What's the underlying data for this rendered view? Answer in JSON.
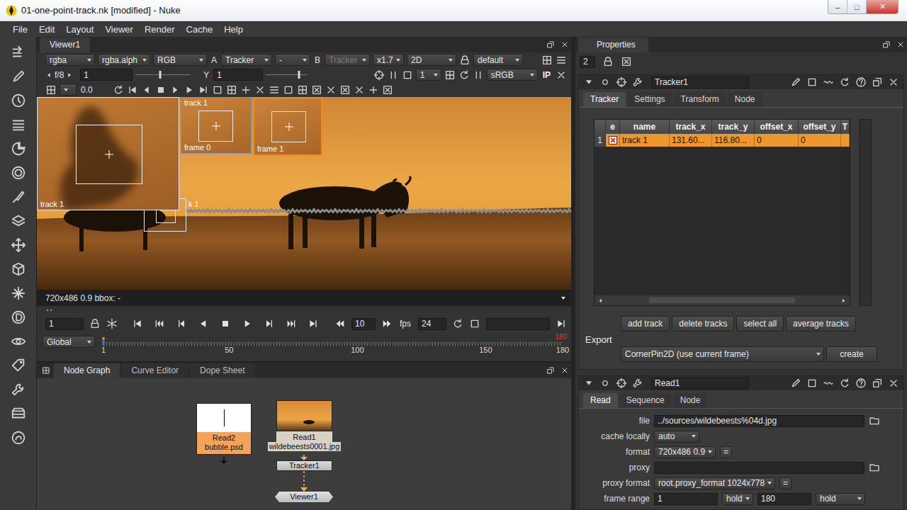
{
  "window": {
    "title": "01-one-point-track.nk [modified] - Nuke",
    "controls": [
      "–",
      "□",
      "✕"
    ]
  },
  "menu": [
    "File",
    "Edit",
    "Layout",
    "Viewer",
    "Render",
    "Cache",
    "Help"
  ],
  "viewer": {
    "tab": "Viewer1",
    "row1": [
      {
        "kind": "dropdown",
        "text": "rgba",
        "disabled": false
      },
      {
        "kind": "dropdown",
        "text": "rgba.alph",
        "disabled": false
      },
      {
        "kind": "dropdown",
        "text": "RGB",
        "disabled": false
      },
      {
        "kind": "label",
        "text": "A",
        "disabled": false
      },
      {
        "kind": "dropdown",
        "text": "Tracker",
        "disabled": false
      },
      {
        "kind": "dropdown",
        "text": "-",
        "disabled": false
      },
      {
        "kind": "label",
        "text": "B",
        "disabled": false
      },
      {
        "kind": "dropdown",
        "text": "Tracker",
        "disabled": true
      },
      {
        "kind": "dropdown",
        "text": "x1.7",
        "disabled": false
      },
      {
        "kind": "dropdown",
        "text": "2D",
        "disabled": false
      },
      {
        "kind": "dropdown",
        "text": "default",
        "disabled": false
      }
    ],
    "row2": {
      "fstop": "f/8",
      "gain": "1",
      "gainLevel": 0.45,
      "gammaLabel": "Y",
      "gamma": "1",
      "gammaLevel": 0.8,
      "proxyLevel": "1",
      "colorspace": "sRGB",
      "ip": "IP"
    },
    "row3": {
      "clip": "0.0"
    },
    "overlays": {
      "zoomLabel": "track 1",
      "thumbsTitle": "track 1",
      "thumbs": [
        {
          "label": "frame 0",
          "selected": false
        },
        {
          "label": "frame 1",
          "selected": true
        }
      ],
      "markerLabel": "k 1"
    },
    "info": "720x486 0.9 bbox: -",
    "transport": {
      "frame": "1",
      "increment": "10",
      "fpsLabel": "fps",
      "fps": "24"
    },
    "timeline": {
      "range": "Global",
      "ticks": [
        "1",
        "50",
        "100",
        "150",
        "180"
      ],
      "outPoint": "180",
      "playhead": 0
    }
  },
  "nodeGraph": {
    "tabs": [
      {
        "label": "Node Graph",
        "selected": true
      },
      {
        "label": "Curve Editor",
        "selected": false
      },
      {
        "label": "Dope Sheet",
        "selected": false
      }
    ],
    "nodes": [
      {
        "kind": "read-psd",
        "name": "Read2",
        "detail": "bubble.psd"
      },
      {
        "kind": "read",
        "name": "Read1",
        "detail": "wildebeests0001.jpg"
      },
      {
        "kind": "tracker",
        "name": "Tracker1",
        "detail": ""
      },
      {
        "kind": "viewer",
        "name": "Viewer1",
        "detail": ""
      }
    ]
  },
  "properties": {
    "title": "Properties",
    "maxPanels": "2",
    "tracker": {
      "name": "Tracker1",
      "tabs": [
        {
          "label": "Tracker",
          "selected": true
        },
        {
          "label": "Settings",
          "selected": false
        },
        {
          "label": "Transform",
          "selected": false
        },
        {
          "label": "Node",
          "selected": false
        }
      ],
      "columns": [
        "e",
        "name",
        "track_x",
        "track_y",
        "offset_x",
        "offset_y",
        "T"
      ],
      "rows": [
        {
          "index": "1",
          "enabled": true,
          "selected": true,
          "cells": [
            "track 1",
            "131.60...",
            "116.80...",
            "0",
            "0"
          ]
        }
      ],
      "buttons": [
        "add track",
        "delete tracks",
        "select all",
        "average tracks"
      ],
      "exportLabel": "Export",
      "exportMode": "CornerPin2D (use current frame)",
      "createButton": "create"
    },
    "read": {
      "name": "Read1",
      "tabs": [
        {
          "label": "Read",
          "selected": true
        },
        {
          "label": "Sequence",
          "selected": false
        },
        {
          "label": "Node",
          "selected": false
        }
      ],
      "fields": [
        {
          "kind": "file",
          "label": "file",
          "value": "../sources/wildebeests%04d.jpg"
        },
        {
          "kind": "dropdown",
          "label": "cache locally",
          "value": "auto"
        },
        {
          "kind": "dropdown-eq",
          "label": "format",
          "value": "720x486 0.9",
          "button": "="
        },
        {
          "kind": "file",
          "label": "proxy",
          "value": ""
        },
        {
          "kind": "dropdown-eq",
          "label": "proxy format",
          "value": "root.proxy_format 1024x778",
          "button": "="
        },
        {
          "kind": "range",
          "label": "frame range",
          "value": "1",
          "before": "hold",
          "end": "180",
          "after": "hold"
        }
      ]
    }
  }
}
